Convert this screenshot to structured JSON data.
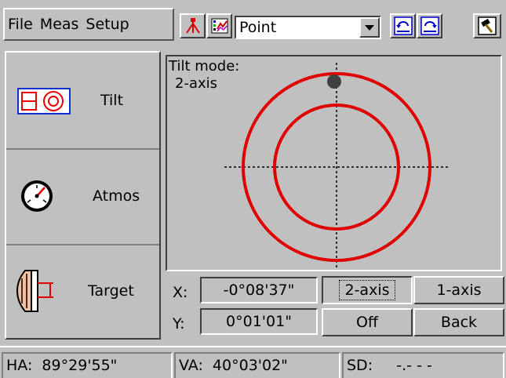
{
  "menu": {
    "file": "File",
    "meas": "Meas",
    "setup": "Setup"
  },
  "toolbar": {
    "instrument_icon": "tripod-icon",
    "graph_icon": "color-graph-icon",
    "mode_value": "Point",
    "undo_icon": "undo-icon",
    "redo_icon": "redo-icon",
    "exit_icon": "hammer-exit-icon"
  },
  "sidebar": {
    "items": [
      {
        "label": "Tilt",
        "icon": "tilt-icon"
      },
      {
        "label": "Atmos",
        "icon": "gauge-icon"
      },
      {
        "label": "Target",
        "icon": "prism-target-icon"
      }
    ]
  },
  "plot": {
    "mode_label": "Tilt mode:",
    "mode_value": "2-axis",
    "colors": {
      "circle": "#e00000",
      "bubble": "#404040",
      "crosshair": "#000000"
    }
  },
  "readouts": {
    "x_label": "X:",
    "x_value": "-0°08'37\"",
    "y_label": "Y:",
    "y_value": "0°01'01\""
  },
  "buttons": {
    "two_axis": "2-axis",
    "one_axis": "1-axis",
    "off": "Off",
    "back": "Back"
  },
  "status": {
    "ha": "HA:  89°29'55\"",
    "va": "VA:  40°03'02\"",
    "sd": "SD:     -.- - -"
  }
}
